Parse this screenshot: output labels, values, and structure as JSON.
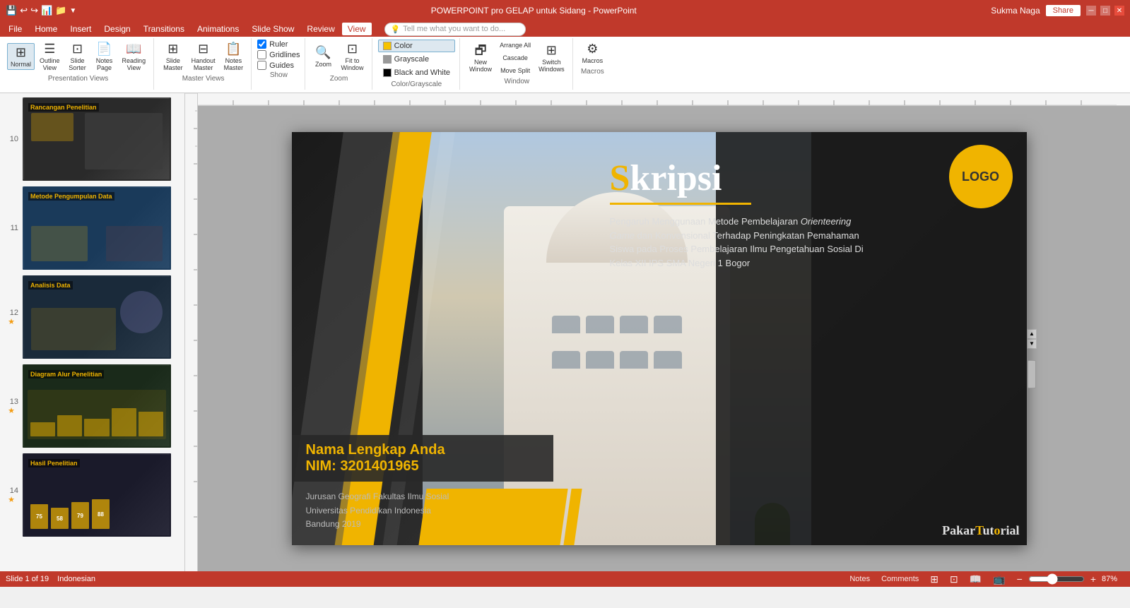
{
  "titlebar": {
    "title": "POWERPOINT pro GELAP untuk Sidang - PowerPoint",
    "user": "Sukma Naga",
    "share": "Share"
  },
  "menubar": {
    "items": [
      "File",
      "Home",
      "Insert",
      "Design",
      "Transitions",
      "Animations",
      "Slide Show",
      "Review",
      "View"
    ]
  },
  "ribbon": {
    "activeTab": "View",
    "presentationViews": {
      "label": "Presentation Views",
      "buttons": [
        {
          "id": "normal",
          "icon": "⊞",
          "label": "Normal"
        },
        {
          "id": "outline",
          "icon": "☰",
          "label": "Outline\nView"
        },
        {
          "id": "slide-sorter",
          "icon": "⊡",
          "label": "Slide\nSorter"
        },
        {
          "id": "notes-page",
          "icon": "📄",
          "label": "Notes\nPage"
        },
        {
          "id": "reading-view",
          "icon": "📖",
          "label": "Reading\nView"
        }
      ]
    },
    "masterViews": {
      "label": "Master Views",
      "buttons": [
        {
          "id": "slide-master",
          "icon": "⊞",
          "label": "Slide\nMaster"
        },
        {
          "id": "handout-master",
          "icon": "⊟",
          "label": "Handout\nMaster"
        },
        {
          "id": "notes-master",
          "icon": "📋",
          "label": "Notes\nMaster"
        }
      ]
    },
    "show": {
      "label": "Show",
      "checkboxes": [
        {
          "id": "ruler",
          "label": "Ruler",
          "checked": true
        },
        {
          "id": "gridlines",
          "label": "Gridlines",
          "checked": false
        },
        {
          "id": "guides",
          "label": "Guides",
          "checked": false
        }
      ]
    },
    "zoom": {
      "label": "Zoom",
      "buttons": [
        {
          "id": "zoom",
          "icon": "🔍",
          "label": "Zoom"
        },
        {
          "id": "fit-to-window",
          "icon": "⊡",
          "label": "Fit to\nWindow"
        }
      ]
    },
    "color": {
      "label": "Color/Grayscale",
      "buttons": [
        {
          "id": "color",
          "label": "Color",
          "dot": "#f5c200",
          "active": true
        },
        {
          "id": "grayscale",
          "label": "Grayscale",
          "dot": "#999"
        },
        {
          "id": "black-white",
          "label": "Black and White",
          "dot": "#000"
        }
      ]
    },
    "window": {
      "label": "Window",
      "buttons": [
        {
          "id": "new-window",
          "icon": "⊞",
          "label": "New\nWindow"
        },
        {
          "id": "arrange-all",
          "label": "Arrange All"
        },
        {
          "id": "cascade",
          "label": "Cascade"
        },
        {
          "id": "move-split",
          "label": "Move Split"
        },
        {
          "id": "switch-windows",
          "icon": "⊞",
          "label": "Switch\nWindows"
        }
      ]
    },
    "macros": {
      "label": "Macros",
      "buttons": [
        {
          "id": "macros",
          "icon": "▶",
          "label": "Macros"
        }
      ]
    },
    "tellMe": "Tell me what you want to do..."
  },
  "slides": [
    {
      "num": "10",
      "star": false,
      "label": "Rancangan Penelitian",
      "thumb_class": "thumb-10"
    },
    {
      "num": "11",
      "star": false,
      "label": "Metode Pengumpulan Data",
      "thumb_class": "thumb-11"
    },
    {
      "num": "12",
      "star": true,
      "label": "Analisis Data",
      "thumb_class": "thumb-12"
    },
    {
      "num": "13",
      "star": true,
      "label": "Diagram Alur Penelitian",
      "thumb_class": "thumb-13"
    },
    {
      "num": "14",
      "star": true,
      "label": "Hasil Penelitian",
      "thumb_class": "thumb-14"
    }
  ],
  "slide": {
    "title": "Skripsi",
    "title_s": "S",
    "logo": "LOGO",
    "description": "Pengaruh Menggunaan Metode Pembelajaran Orienteering Game dan Konvensional Terhadap Peningkatan Pemahaman Siswa pada Proses Pembelajaran Ilmu Pengetahuan Sosial Di Kelas XII IPS SMA Negeri 1 Bogor",
    "name": "Nama Lengkap Anda",
    "nim": "NIM: 3201401965",
    "faculty": "Jurusan Geografi  Fakultas Ilmu Sosial",
    "university": "Universitas Pendidikan Indonesia",
    "city_year": "Bandung 2019",
    "brand": "PakarTutorial",
    "brand_highlight": "o"
  },
  "statusbar": {
    "slide_info": "Slide 1 of 19",
    "language": "Indonesian",
    "notes": "Notes",
    "comments": "Comments",
    "zoom": "87%",
    "view_icons": [
      "normal",
      "slide-sorter",
      "reading",
      "presenter"
    ]
  }
}
